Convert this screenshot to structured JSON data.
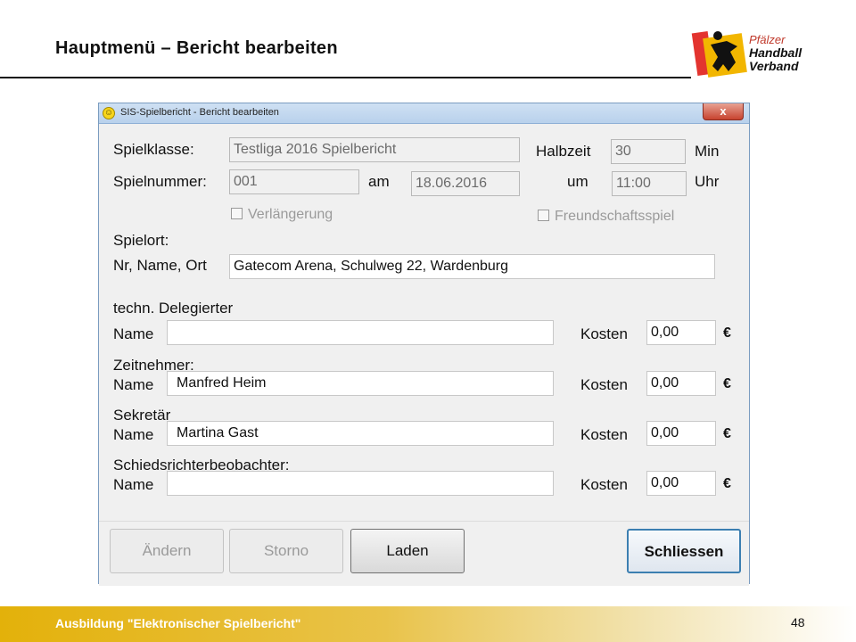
{
  "slide": {
    "title": "Hauptmenü – Bericht bearbeiten",
    "footer": "Ausbildung \"Elektronischer Spielbericht\"",
    "page_number": "48"
  },
  "logo": {
    "line1": "Pfälzer",
    "line2": "Handball",
    "line3": "Verband",
    "colors": {
      "red": "#e3342f",
      "yellow": "#f2b600",
      "black": "#111111"
    }
  },
  "window": {
    "title": "SIS-Spielbericht - Bericht bearbeiten",
    "close": "x",
    "icon": "smiley-icon"
  },
  "form": {
    "spielklasse_label": "Spielklasse:",
    "spielklasse_value": "Testliga 2016 Spielbericht",
    "halbzeit_label": "Halbzeit",
    "halbzeit_value": "30",
    "halbzeit_unit": "Min",
    "spielnummer_label": "Spielnummer:",
    "spielnummer_value": "001",
    "am_label": "am",
    "datum_value": "18.06.2016",
    "um_label": "um",
    "uhrzeit_value": "11:00",
    "uhr_label": "Uhr",
    "verlaengerung_label": "Verlängerung",
    "freundschaftsspiel_label": "Freundschaftsspiel",
    "spielort_label": "Spielort:",
    "ort_label": "Nr, Name, Ort",
    "ort_value": "Gatecom Arena, Schulweg 22, Wardenburg",
    "sections": [
      {
        "heading": "techn. Delegierter",
        "name_label": "Name",
        "name_value": "",
        "kosten_label": "Kosten",
        "kosten_value": "0,00",
        "currency": "€"
      },
      {
        "heading": "Zeitnehmer:",
        "name_label": "Name",
        "name_value": "Manfred Heim",
        "kosten_label": "Kosten",
        "kosten_value": "0,00",
        "currency": "€"
      },
      {
        "heading": "Sekretär",
        "name_label": "Name",
        "name_value": "Martina Gast",
        "kosten_label": "Kosten",
        "kosten_value": "0,00",
        "currency": "€"
      },
      {
        "heading": "Schiedsrichterbeobachter:",
        "name_label": "Name",
        "name_value": "",
        "kosten_label": "Kosten",
        "kosten_value": "0,00",
        "currency": "€"
      }
    ]
  },
  "buttons": {
    "aendern": "Ändern",
    "storno": "Storno",
    "laden": "Laden",
    "schliessen": "Schliessen"
  }
}
